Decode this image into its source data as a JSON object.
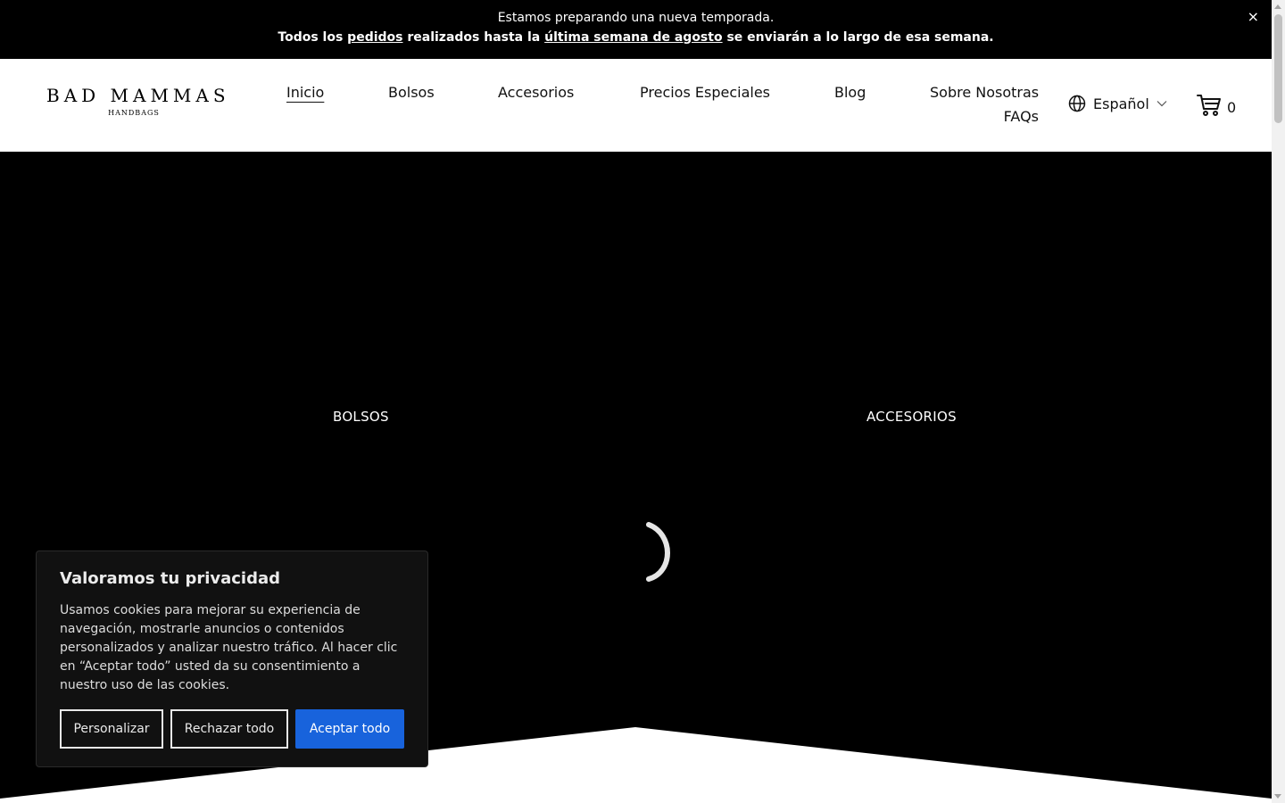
{
  "announcement": {
    "line1": "Estamos preparando una nueva temporada.",
    "line2_a": "Todos los ",
    "line2_link1": "pedidos",
    "line2_b": " realizados hasta la ",
    "line2_link2": "última semana de agosto",
    "line2_c": " se enviarán a lo largo de esa semana.",
    "close": "×"
  },
  "logo": {
    "main": "BAD MAMMAS",
    "sub": "HANDBAGS"
  },
  "nav": {
    "items": [
      {
        "label": "Inicio",
        "active": true
      },
      {
        "label": "Bolsos"
      },
      {
        "label": "Accesorios"
      },
      {
        "label": "Precios Especiales"
      },
      {
        "label": "Blog"
      },
      {
        "label": "Sobre Nosotras"
      },
      {
        "label": "FAQs"
      }
    ]
  },
  "language": {
    "label": "Español",
    "icon": "globe-icon"
  },
  "cart": {
    "count": "0",
    "icon": "cart-icon"
  },
  "hero": {
    "left_label": "BOLSOS",
    "right_label": "ACCESORIOS",
    "background": "#000000"
  },
  "cookie": {
    "title": "Valoramos tu privacidad",
    "text": "Usamos cookies para mejorar su experiencia de navegación, mostrarle anuncios o contenidos personalizados y analizar nuestro tráfico. Al hacer clic en “Aceptar todo” usted da su consentimiento a nuestro uso de las cookies.",
    "customize": "Personalizar",
    "reject": "Rechazar todo",
    "accept": "Aceptar todo",
    "accent": "#1863dc"
  }
}
